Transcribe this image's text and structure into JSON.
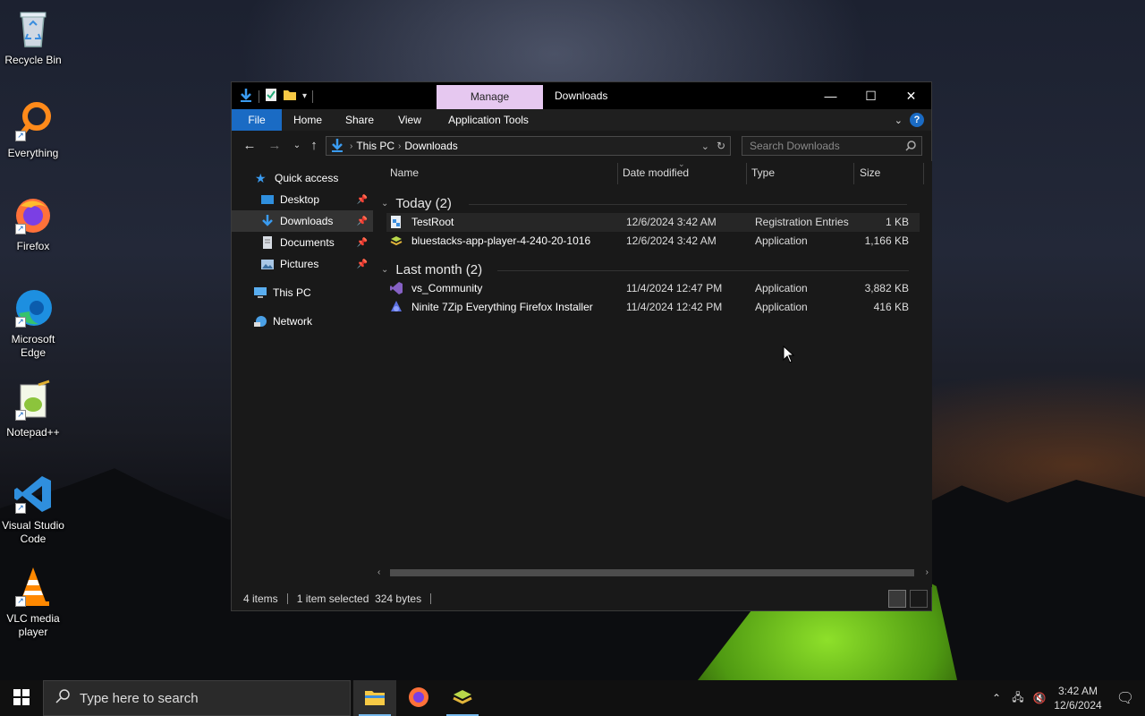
{
  "desktop": {
    "icons": [
      {
        "label": "Recycle Bin"
      },
      {
        "label": "Everything"
      },
      {
        "label": "Firefox"
      },
      {
        "label": "Microsoft Edge"
      },
      {
        "label": "Notepad++"
      },
      {
        "label": "Visual Studio Code"
      },
      {
        "label": "VLC media player"
      }
    ]
  },
  "window": {
    "title": "Downloads",
    "context_tab": "Manage",
    "ribbon_tabs": [
      "File",
      "Home",
      "Share",
      "View",
      "Application Tools"
    ],
    "address": {
      "crumbs": [
        "This PC",
        "Downloads"
      ]
    },
    "search_placeholder": "Search Downloads",
    "nav": {
      "quick_access": "Quick access",
      "items": [
        "Desktop",
        "Downloads",
        "Documents",
        "Pictures"
      ],
      "this_pc": "This PC",
      "network": "Network"
    },
    "columns": [
      "Name",
      "Date modified",
      "Type",
      "Size"
    ],
    "groups": [
      {
        "label": "Today (2)",
        "files": [
          {
            "name": "TestRoot",
            "date": "12/6/2024 3:42 AM",
            "type": "Registration Entries",
            "size": "1 KB"
          },
          {
            "name": "bluestacks-app-player-4-240-20-1016",
            "date": "12/6/2024 3:42 AM",
            "type": "Application",
            "size": "1,166 KB"
          }
        ]
      },
      {
        "label": "Last month (2)",
        "files": [
          {
            "name": "vs_Community",
            "date": "11/4/2024 12:47 PM",
            "type": "Application",
            "size": "3,882 KB"
          },
          {
            "name": "Ninite 7Zip Everything Firefox Installer",
            "date": "11/4/2024 12:42 PM",
            "type": "Application",
            "size": "416 KB"
          }
        ]
      }
    ],
    "status": {
      "count": "4 items",
      "selection": "1 item selected  324 bytes"
    }
  },
  "taskbar": {
    "search_placeholder": "Type here to search",
    "time": "3:42 AM",
    "date": "12/6/2024"
  },
  "colors": {
    "accent": "#1a6bc4",
    "context_tab": "#e6c8f0"
  }
}
